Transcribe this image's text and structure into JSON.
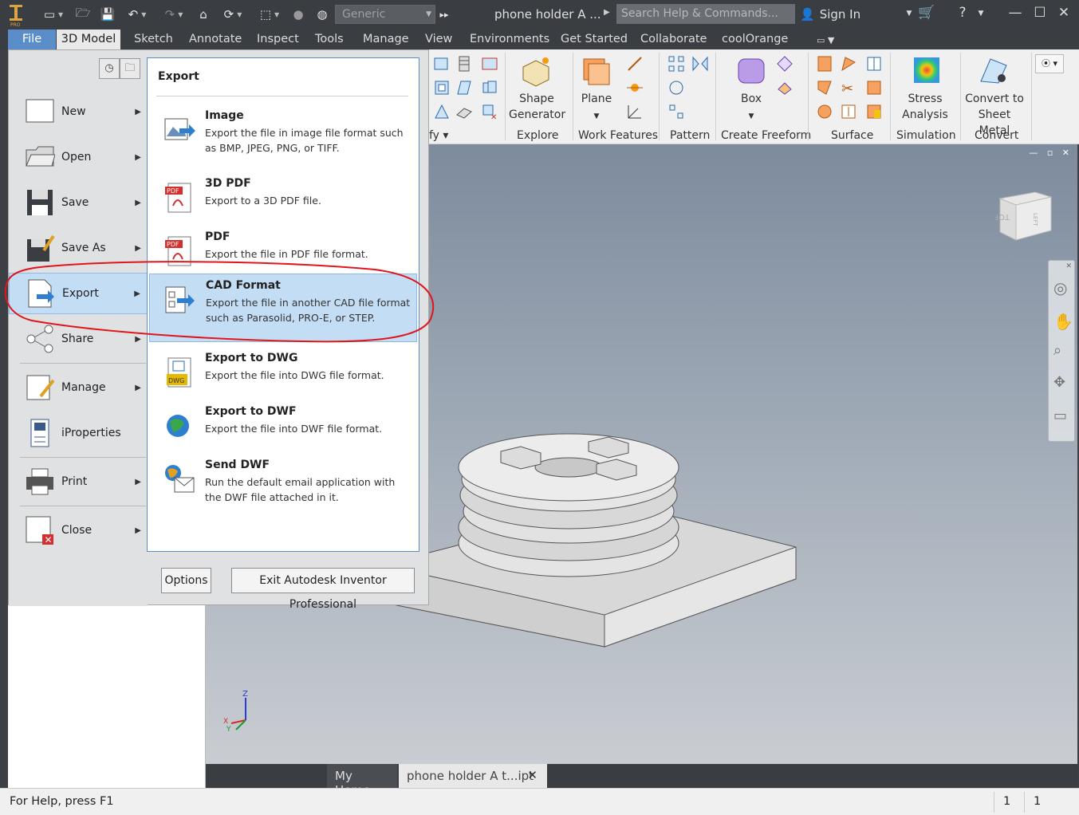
{
  "titlebar": {
    "appearance_value": "Generic",
    "document_title": "phone holder A ...",
    "search_placeholder": "Search Help & Commands...",
    "sign_in": "Sign In"
  },
  "menubar": {
    "tabs": [
      "File",
      "3D Model",
      "Sketch",
      "Annotate",
      "Inspect",
      "Tools",
      "Manage",
      "View",
      "Environments",
      "Get Started",
      "Collaborate",
      "coolOrange"
    ]
  },
  "ribbon": {
    "partial_label": "fy",
    "buttons": {
      "shape_generator": [
        "Shape",
        "Generator"
      ],
      "plane": "Plane",
      "box": "Box",
      "stress_analysis": [
        "Stress",
        "Analysis"
      ],
      "convert_sheet_metal": [
        "Convert to",
        "Sheet Metal"
      ]
    },
    "groups": [
      "Explore",
      "Work Features",
      "Pattern",
      "Create Freeform",
      "Surface",
      "Simulation",
      "Convert"
    ]
  },
  "file_menu": {
    "items": [
      {
        "label": "New",
        "has_arrow": true
      },
      {
        "label": "Open",
        "has_arrow": true
      },
      {
        "label": "Save",
        "has_arrow": true
      },
      {
        "label": "Save As",
        "has_arrow": true
      },
      {
        "label": "Export",
        "has_arrow": true,
        "active": true
      },
      {
        "label": "Share",
        "has_arrow": true
      },
      {
        "label": "Manage",
        "has_arrow": true
      },
      {
        "label": "iProperties",
        "has_arrow": false
      },
      {
        "label": "Print",
        "has_arrow": true
      },
      {
        "label": "Close",
        "has_arrow": true
      }
    ],
    "panel": {
      "title": "Export",
      "items": [
        {
          "title": "Image",
          "desc": "Export the file in image file format such as BMP, JPEG, PNG, or TIFF."
        },
        {
          "title": "3D PDF",
          "desc": "Export to a 3D PDF file."
        },
        {
          "title": "PDF",
          "desc": "Export the file in PDF file format."
        },
        {
          "title": "CAD Format",
          "desc": "Export the file in another CAD file format such as Parasolid, PRO-E, or STEP.",
          "active": true
        },
        {
          "title": "Export to DWG",
          "desc": "Export the file into DWG file format."
        },
        {
          "title": "Export to DWF",
          "desc": "Export the file into DWF file format."
        },
        {
          "title": "Send DWF",
          "desc": "Run the default email application with the DWF file attached in it."
        }
      ]
    },
    "options_button": "Options",
    "exit_button": "Exit Autodesk Inventor Professional"
  },
  "viewcube": {
    "top_label": "TOP",
    "left_label": "LEFT"
  },
  "triad": {
    "z": "Z",
    "x": "X",
    "y": "Y"
  },
  "doc_tabs": {
    "home": "My Home",
    "part": "phone holder A t...ipt"
  },
  "statusbar": {
    "help": "For Help, press F1",
    "count_a": "1",
    "count_b": "1"
  },
  "colors": {
    "accent": "#5b8dc9",
    "highlight": "#c3ddf5",
    "annotation": "#e0161c"
  }
}
